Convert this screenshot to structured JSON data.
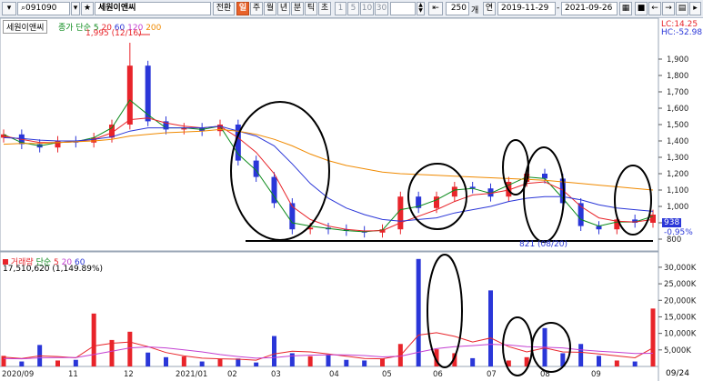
{
  "toolbar": {
    "code": "091090",
    "star": "★",
    "name": "세원이앤씨",
    "convert": "전환",
    "period_active": "일",
    "periods": [
      "주",
      "월",
      "년",
      "분",
      "틱",
      "초"
    ],
    "minutes": [
      "1",
      "5",
      "10",
      "30"
    ],
    "count": "250",
    "count_unit": "개",
    "range_label": "연",
    "date_from": "2019-11-29",
    "date_to": "2021-09-26"
  },
  "upper": {
    "stock_tag": "세원이앤씨",
    "ma_prefix": "종가 단순",
    "ma_labels": [
      "5",
      "20",
      "60",
      "120",
      "200"
    ],
    "lc": "LC:14.25",
    "hc": "HC:-52.98",
    "high_label": "1,995 (12/16)",
    "low_label": "821 (08/20)",
    "last_price": "938",
    "change": "-0.95%"
  },
  "lower": {
    "title": "거래량",
    "ma_prefix": "단순",
    "ma_labels": [
      "5",
      "20",
      "60"
    ],
    "volume_text": "17,510,620 (1,149.89%)"
  },
  "axis": {
    "x_labels": [
      "2020/09",
      "11",
      "12",
      "2021/01",
      "02",
      "03",
      "04",
      "05",
      "06",
      "07",
      "08",
      "09"
    ],
    "last_date": "09/24"
  },
  "colors": {
    "up": "#e8242a",
    "down": "#2a36d8",
    "ma5": "#e8242a",
    "ma20": "#2a36d8",
    "ma60": "#c33fd1",
    "ma120": "#f08a00"
  },
  "chart_data": [
    {
      "type": "candlestick",
      "title": "세원이앤씨",
      "x_range": [
        "2020-09",
        "2021-09-24"
      ],
      "ylim": [
        750,
        2050
      ],
      "y_ticks": [
        800,
        900,
        1000,
        1100,
        1200,
        1300,
        1400,
        1500,
        1600,
        1700,
        1800,
        1900
      ],
      "series": [
        {
          "name": "종가",
          "values": [
            1440,
            1380,
            1360,
            1400,
            1390,
            1420,
            1500,
            1860,
            1520,
            1470,
            1480,
            1460,
            1500,
            1280,
            1180,
            1020,
            860,
            870,
            860,
            850,
            840,
            860,
            1060,
            990,
            1060,
            1120,
            1110,
            1060,
            1150,
            1200,
            1170,
            1020,
            880,
            860,
            920,
            900,
            950
          ]
        },
        {
          "name": "5",
          "values": [
            1440,
            1390,
            1370,
            1390,
            1395,
            1420,
            1480,
            1650,
            1560,
            1480,
            1480,
            1470,
            1490,
            1320,
            1220,
            1060,
            900,
            880,
            865,
            852,
            845,
            855,
            980,
            1000,
            1040,
            1100,
            1110,
            1080,
            1130,
            1180,
            1170,
            1050,
            920,
            880,
            905,
            905,
            940
          ]
        },
        {
          "name": "20",
          "values": [
            1430,
            1410,
            1390,
            1390,
            1395,
            1410,
            1450,
            1530,
            1540,
            1510,
            1490,
            1480,
            1490,
            1420,
            1330,
            1200,
            1000,
            920,
            880,
            860,
            850,
            852,
            900,
            940,
            980,
            1030,
            1070,
            1080,
            1100,
            1140,
            1150,
            1100,
            1000,
            930,
            910,
            905,
            920
          ]
        },
        {
          "name": "60",
          "values": [
            1420,
            1415,
            1405,
            1400,
            1400,
            1410,
            1425,
            1460,
            1480,
            1480,
            1480,
            1480,
            1490,
            1460,
            1430,
            1370,
            1260,
            1140,
            1050,
            990,
            950,
            920,
            910,
            920,
            930,
            960,
            980,
            1000,
            1030,
            1050,
            1060,
            1060,
            1040,
            1010,
            990,
            980,
            970
          ]
        },
        {
          "name": "120",
          "values": [
            1380,
            1385,
            1385,
            1390,
            1395,
            1400,
            1410,
            1430,
            1440,
            1450,
            1455,
            1460,
            1470,
            1460,
            1440,
            1410,
            1370,
            1320,
            1280,
            1250,
            1230,
            1210,
            1200,
            1195,
            1190,
            1185,
            1180,
            1175,
            1170,
            1165,
            1160,
            1150,
            1140,
            1130,
            1120,
            1110,
            1100
          ]
        }
      ],
      "annotations": [
        "1,995 (12/16)",
        "821 (08/20)"
      ]
    },
    {
      "type": "bar",
      "title": "거래량",
      "ylim": [
        0,
        33000
      ],
      "y_ticks": [
        5000,
        10000,
        15000,
        20000,
        25000,
        30000
      ],
      "y_tick_labels": [
        "5,000K",
        "10,000K",
        "15,000K",
        "20,000K",
        "25,000K",
        "30,000K"
      ],
      "values_k": [
        3200,
        1500,
        6500,
        1800,
        2000,
        16000,
        8000,
        10500,
        4200,
        2800,
        3000,
        1500,
        2200,
        2400,
        1200,
        9200,
        4000,
        3100,
        3600,
        2000,
        1800,
        2400,
        6800,
        32500,
        5200,
        4000,
        2500,
        23000,
        1800,
        2800,
        11600,
        4000,
        6800,
        3200,
        1800,
        1500,
        17510
      ],
      "series": [
        {
          "name": "5",
          "values_k": [
            2800,
            2400,
            3200,
            3000,
            2600,
            6200,
            7000,
            7400,
            6000,
            4200,
            3200,
            2500,
            2300,
            2200,
            1900,
            3800,
            4600,
            4400,
            3800,
            3100,
            2400,
            2300,
            3300,
            9500,
            10200,
            9100,
            7400,
            8600,
            6000,
            4400,
            5600,
            4400,
            4300,
            3800,
            3200,
            2600,
            5600
          ]
        },
        {
          "name": "20",
          "values_k": [
            2400,
            2300,
            2600,
            2700,
            2700,
            3600,
            4600,
            5600,
            5900,
            5600,
            5000,
            4400,
            3600,
            3000,
            2500,
            2700,
            3200,
            3400,
            3500,
            3500,
            3300,
            2900,
            3100,
            4300,
            5400,
            6000,
            6300,
            6700,
            6500,
            6000,
            5800,
            5600,
            5000,
            4600,
            4300,
            3900,
            4000
          ]
        }
      ]
    }
  ]
}
